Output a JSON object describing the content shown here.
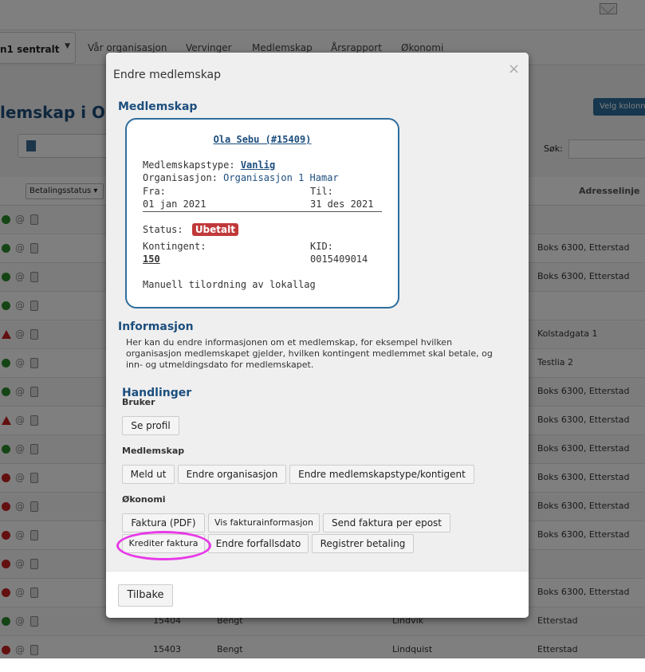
{
  "background": {
    "org_select": "n1 sentralt",
    "nav": [
      "Vår organisasjon",
      "Vervinger",
      "Medlemskap",
      "Årsrapport",
      "Økonomi"
    ],
    "page_title": "lemskap i Org",
    "velg_button": "Velg kolonner",
    "search_label": "Søk:",
    "status_filter": "Betalingsstatus",
    "address_header": "Adresselinje",
    "rows": [
      {
        "dot": "green",
        "addr": "",
        "num": "",
        "fname": "",
        "lname": ""
      },
      {
        "dot": "green",
        "addr": "Boks 6300, Etterstad",
        "num": "",
        "fname": "",
        "lname": ""
      },
      {
        "dot": "green",
        "addr": "Boks 6300, Etterstad",
        "num": "",
        "fname": "",
        "lname": ""
      },
      {
        "dot": "green",
        "addr": "",
        "num": "",
        "fname": "",
        "lname": ""
      },
      {
        "dot": "warn",
        "addr": "Kolstadgata 1",
        "num": "",
        "fname": "",
        "lname": ""
      },
      {
        "dot": "green",
        "addr": "Testlia 2",
        "num": "",
        "fname": "",
        "lname": ""
      },
      {
        "dot": "green",
        "addr": "Boks 6300, Etterstad",
        "num": "",
        "fname": "",
        "lname": ""
      },
      {
        "dot": "warn",
        "addr": "Boks 6300, Etterstad",
        "num": "",
        "fname": "",
        "lname": ""
      },
      {
        "dot": "green",
        "addr": "Boks 6300, Etterstad",
        "num": "",
        "fname": "",
        "lname": ""
      },
      {
        "dot": "red",
        "addr": "Boks 6300, Etterstad",
        "num": "",
        "fname": "",
        "lname": ""
      },
      {
        "dot": "red",
        "addr": "Boks 6300, Etterstad",
        "num": "",
        "fname": "",
        "lname": ""
      },
      {
        "dot": "red",
        "addr": "Boks 6300, Etterstad",
        "num": "",
        "fname": "",
        "lname": ""
      },
      {
        "dot": "red",
        "addr": "",
        "num": "",
        "fname": "",
        "lname": ""
      },
      {
        "dot": "red",
        "addr": "Boks 6300, Etterstad",
        "num": "",
        "fname": "",
        "lname": ""
      },
      {
        "dot": "green",
        "addr": "Etterstad",
        "num": "15404",
        "fname": "Bengt",
        "lname": "Lindvik"
      },
      {
        "dot": "red",
        "addr": "Etterstad",
        "num": "15403",
        "fname": "Bengt",
        "lname": "Lindquist"
      }
    ]
  },
  "modal": {
    "title": "Endre medlemskap",
    "close_glyph": "×",
    "membership_section": "Medlemskap",
    "card": {
      "name": "Ola Sebu (#15409)",
      "type_label": "Medlemskapstype:",
      "type_value": "Vanlig",
      "org_label": "Organisasjon:",
      "org_value": "Organisasjon 1 Hamar",
      "from_label": "Fra:",
      "from_value": "01 jan 2021",
      "to_label": "Til:",
      "to_value": "31 des 2021",
      "status_label": "Status:",
      "status_value": "Ubetalt",
      "fee_label": "Kontingent:",
      "fee_value": "150",
      "kid_label": "KID:",
      "kid_value": "0015409014",
      "assignment": "Manuell tilordning av lokallag"
    },
    "info_section": "Informasjon",
    "info_text": "Her kan du endre informasjonen om et medlemskap, for eksempel hvilken organisasjon medlemskapet gjelder, hvilken kontingent medlemmet skal betale, og inn- og utmeldingsdato for medlemskapet.",
    "actions_section": "Handlinger",
    "user_group": "Bruker",
    "see_profile": "Se profil",
    "membership_group": "Medlemskap",
    "resign": "Meld ut",
    "change_org": "Endre organisasjon",
    "change_type": "Endre medlemskapstype/kontigent",
    "economy_group": "Økonomi",
    "invoice_pdf": "Faktura (PDF)",
    "invoice_info": "Vis fakturainformasjon",
    "send_invoice": "Send faktura per epost",
    "credit_invoice": "Krediter faktura",
    "change_due": "Endre forfallsdato",
    "register_payment": "Registrer betaling",
    "back": "Tilbake"
  },
  "colors": {
    "accent": "#1c4e7d",
    "status_unpaid": "#c0393a",
    "highlight": "#e838e8"
  }
}
